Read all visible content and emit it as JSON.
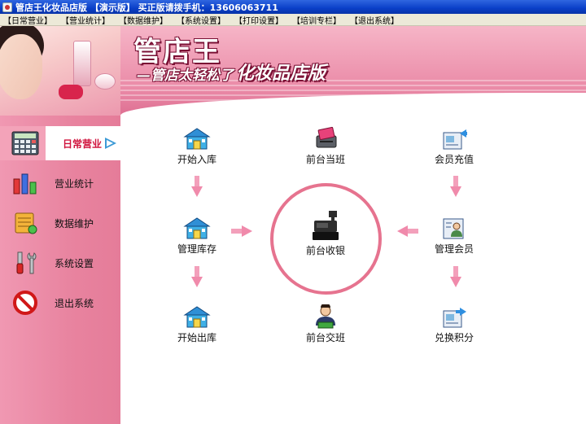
{
  "window": {
    "title": "管店王化妆品店版 【演示版】 买正版请拨手机：13606063711"
  },
  "menu": [
    {
      "label": "【日常营业】"
    },
    {
      "label": "【营业统计】"
    },
    {
      "label": "【数据维护】"
    },
    {
      "label": "【系统设置】"
    },
    {
      "label": "【打印设置】"
    },
    {
      "label": "【培训专栏】"
    },
    {
      "label": "【退出系统】"
    }
  ],
  "banner": {
    "logo": "管店王",
    "slogan": "—管店太轻松了",
    "edition": "化妆品店版"
  },
  "sidebar": {
    "items": [
      {
        "label": "日常营业",
        "icon": "calculator-icon",
        "active": true
      },
      {
        "label": "营业统计",
        "icon": "bar-chart-icon",
        "active": false
      },
      {
        "label": "数据维护",
        "icon": "database-icon",
        "active": false
      },
      {
        "label": "系统设置",
        "icon": "tools-icon",
        "active": false
      },
      {
        "label": "退出系统",
        "icon": "no-entry-icon",
        "active": false
      }
    ]
  },
  "functions": {
    "stock_in": {
      "label": "开始入库",
      "icon": "store-icon"
    },
    "inventory": {
      "label": "管理库存",
      "icon": "store-icon"
    },
    "stock_out": {
      "label": "开始出库",
      "icon": "store-icon"
    },
    "shift_start": {
      "label": "前台当班",
      "icon": "card-swipe-icon"
    },
    "checkout": {
      "label": "前台收银",
      "icon": "cash-register-icon"
    },
    "shift_handover": {
      "label": "前台交班",
      "icon": "cashier-person-icon"
    },
    "member_recharge": {
      "label": "会员充值",
      "icon": "member-card-in-icon"
    },
    "manage_members": {
      "label": "管理会员",
      "icon": "member-card-icon"
    },
    "redeem_points": {
      "label": "兑换积分",
      "icon": "member-card-out-icon"
    }
  },
  "colors": {
    "accent_pink": "#e6738f",
    "sidebar_pink": "#ec8ba6",
    "active_text": "#d0123c",
    "titlebar_blue": "#0a3fc8"
  }
}
